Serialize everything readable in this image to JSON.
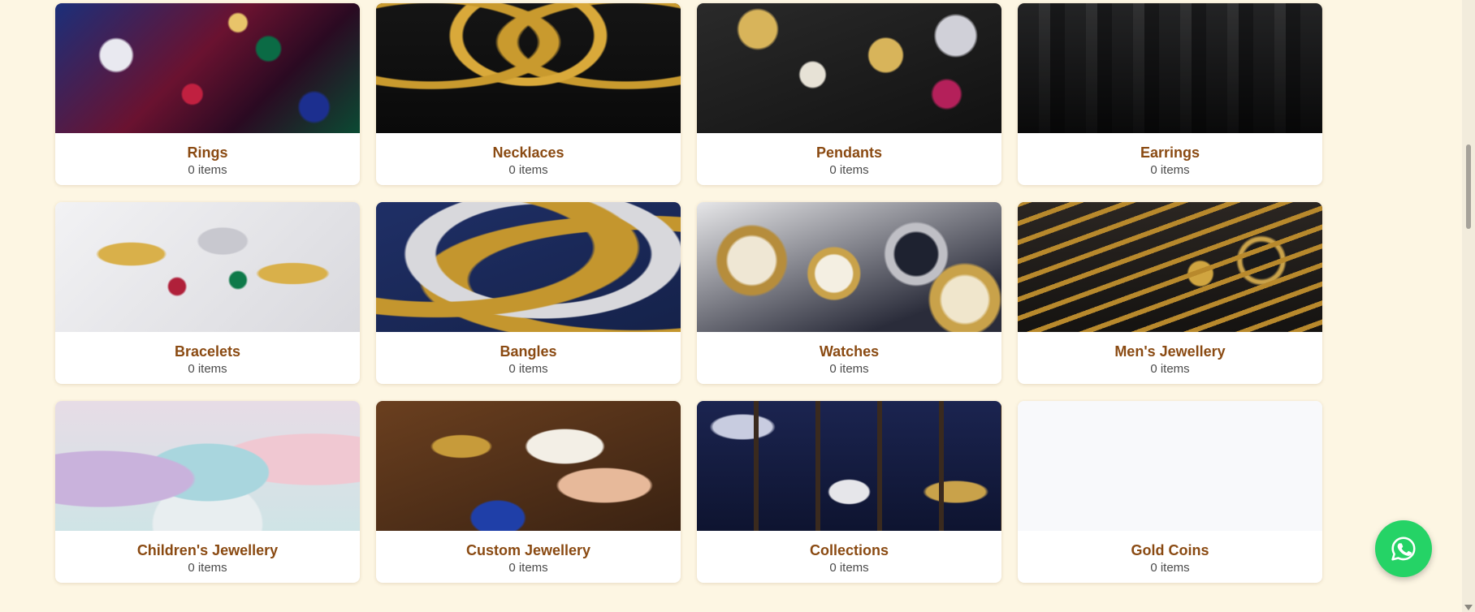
{
  "categories": [
    {
      "name": "Rings",
      "count": "0 items",
      "thumb": "rings-photo"
    },
    {
      "name": "Necklaces",
      "count": "0 items",
      "thumb": "necklaces-photo"
    },
    {
      "name": "Pendants",
      "count": "0 items",
      "thumb": "pendants-photo"
    },
    {
      "name": "Earrings",
      "count": "0 items",
      "thumb": "earrings-photo"
    },
    {
      "name": "Bracelets",
      "count": "0 items",
      "thumb": "bracelets-photo"
    },
    {
      "name": "Bangles",
      "count": "0 items",
      "thumb": "bangles-photo"
    },
    {
      "name": "Watches",
      "count": "0 items",
      "thumb": "watches-photo"
    },
    {
      "name": "Men's Jewellery",
      "count": "0 items",
      "thumb": "mens-jewellery-photo"
    },
    {
      "name": "Children's Jewellery",
      "count": "0 items",
      "thumb": "childrens-jewellery-photo"
    },
    {
      "name": "Custom Jewellery",
      "count": "0 items",
      "thumb": "custom-jewellery-photo"
    },
    {
      "name": "Collections",
      "count": "0 items",
      "thumb": "collections-photo"
    },
    {
      "name": "Gold Coins",
      "count": "0 items",
      "thumb": "no-image"
    }
  ],
  "floating_button": {
    "icon": "whatsapp-icon",
    "color": "#25d366"
  },
  "colors": {
    "background": "#fdf6e3",
    "category_title": "#8a4a12",
    "count_text": "#4b4b4b"
  }
}
